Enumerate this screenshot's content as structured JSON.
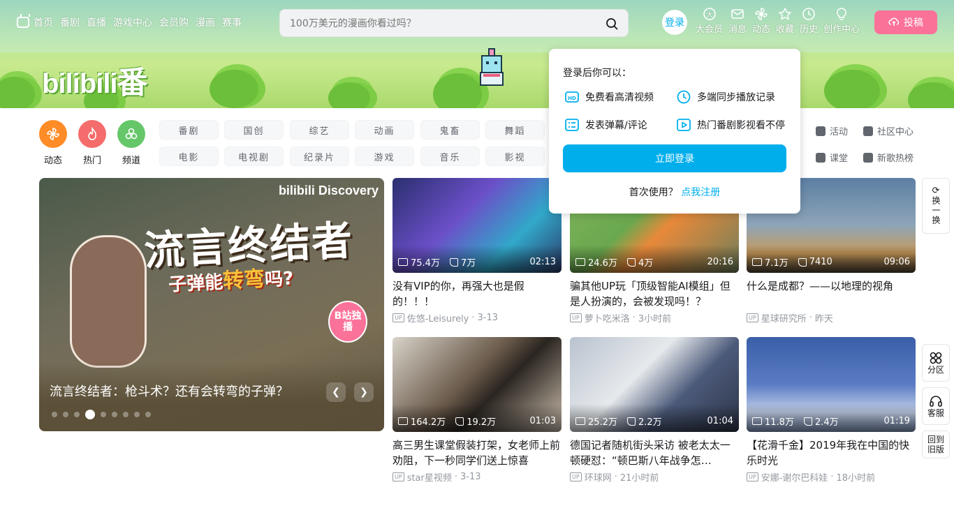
{
  "nav": {
    "left": [
      "首页",
      "番剧",
      "直播",
      "游戏中心",
      "会员购",
      "漫画",
      "赛事"
    ],
    "search_placeholder": "100万美元的漫画你看过吗？",
    "login": "登录",
    "right": [
      "大会员",
      "消息",
      "动态",
      "收藏",
      "历史",
      "创作中心"
    ],
    "upload": "投稿"
  },
  "banner": {
    "logo": "bilibili",
    "logo_suffix": "番"
  },
  "channels": {
    "circles": [
      {
        "label": "动态",
        "color": "#ff8c27"
      },
      {
        "label": "热门",
        "color": "#f56c6c"
      },
      {
        "label": "频道",
        "color": "#66c76a"
      }
    ],
    "tags_row1": [
      "番剧",
      "国创",
      "综艺",
      "动画",
      "鬼畜",
      "舞蹈"
    ],
    "tags_row2": [
      "电影",
      "电视剧",
      "纪录片",
      "游戏",
      "音乐",
      "影视"
    ],
    "links": [
      "活动",
      "社区中心",
      "课堂",
      "新歌热榜"
    ]
  },
  "carousel": {
    "brand": "bilibili  Discovery",
    "art_title": "流言终结者",
    "art_sub_pre": "子弹能",
    "art_sub_key": "转弯",
    "art_sub_post": "吗?",
    "badge": "B站独播",
    "caption": "流言终结者：枪斗术？还有会转弯的子弹？",
    "dots": 9,
    "active_dot": 3
  },
  "videos": [
    {
      "title": "没有VIP的你，再强大也是假的！！！",
      "views": "75.4万",
      "likes": "7万",
      "duration": "02:13",
      "author": "佐悠-Leisurely",
      "date": "3-13",
      "bg": "linear-gradient(135deg,#2a2f6e,#6b4fc8 40%,#31a8c9 70%,#2d3a6a)"
    },
    {
      "title": "骗其他UP玩「顶级智能AI模组」但是人扮演的，会被发现吗！？",
      "views": "24.6万",
      "likes": "4万",
      "duration": "20:16",
      "author": "萝卜吃米洛",
      "date": "3小时前",
      "bg": "linear-gradient(135deg,#7fb35a,#6aa84f 40%,#e8893a 55%,#6f7f5a)"
    },
    {
      "title": "什么是成都？——以地理的视角",
      "views": "7.1万",
      "likes": "7410",
      "duration": "09:06",
      "author": "星球研究所",
      "date": "昨天",
      "bg": "linear-gradient(180deg,#5c7fa3,#8ea5b8 50%,#c99a5a 80%,#4d4232)"
    },
    {
      "title": "高三男生课堂假装打架，女老师上前劝阻，下一秒同学们送上惊喜",
      "views": "164.2万",
      "likes": "19.2万",
      "duration": "01:03",
      "author": "star星视频",
      "date": "3-13",
      "bg": "linear-gradient(135deg,#d8d3c9,#6a5a4a 45%,#2a2520 60%,#cdbfae)"
    },
    {
      "title": "德国记者随机街头采访 被老太太一顿硬怼：“顿巴斯八年战争怎…",
      "views": "25.2万",
      "likes": "2.2万",
      "duration": "01:04",
      "author": "环球网",
      "date": "21小时前",
      "bg": "linear-gradient(135deg,#b9c3cf,#e6e9ec 40%,#4c5a7a 65%,#2d3547)"
    },
    {
      "title": "【花滑千金】2019年我在中国的快乐时光",
      "views": "11.8万",
      "likes": "2.4万",
      "duration": "01:19",
      "author": "安娜-谢尔巴科娃",
      "date": "18小时前",
      "bg": "linear-gradient(180deg,#3a5fa8,#5b7cc4 50%,#c6d2ea 80%,#8aa0c8)"
    }
  ],
  "popup": {
    "header": "登录后你可以：",
    "features": [
      "免费看高清视频",
      "多端同步播放记录",
      "发表弹幕/评论",
      "热门番剧影视看不停"
    ],
    "button": "立即登录",
    "register_prompt": "首次使用？",
    "register_link": "点我注册"
  },
  "sidebar": {
    "refresh": "换一换",
    "zones": "分区",
    "service": "客服",
    "old": "回到旧版"
  }
}
